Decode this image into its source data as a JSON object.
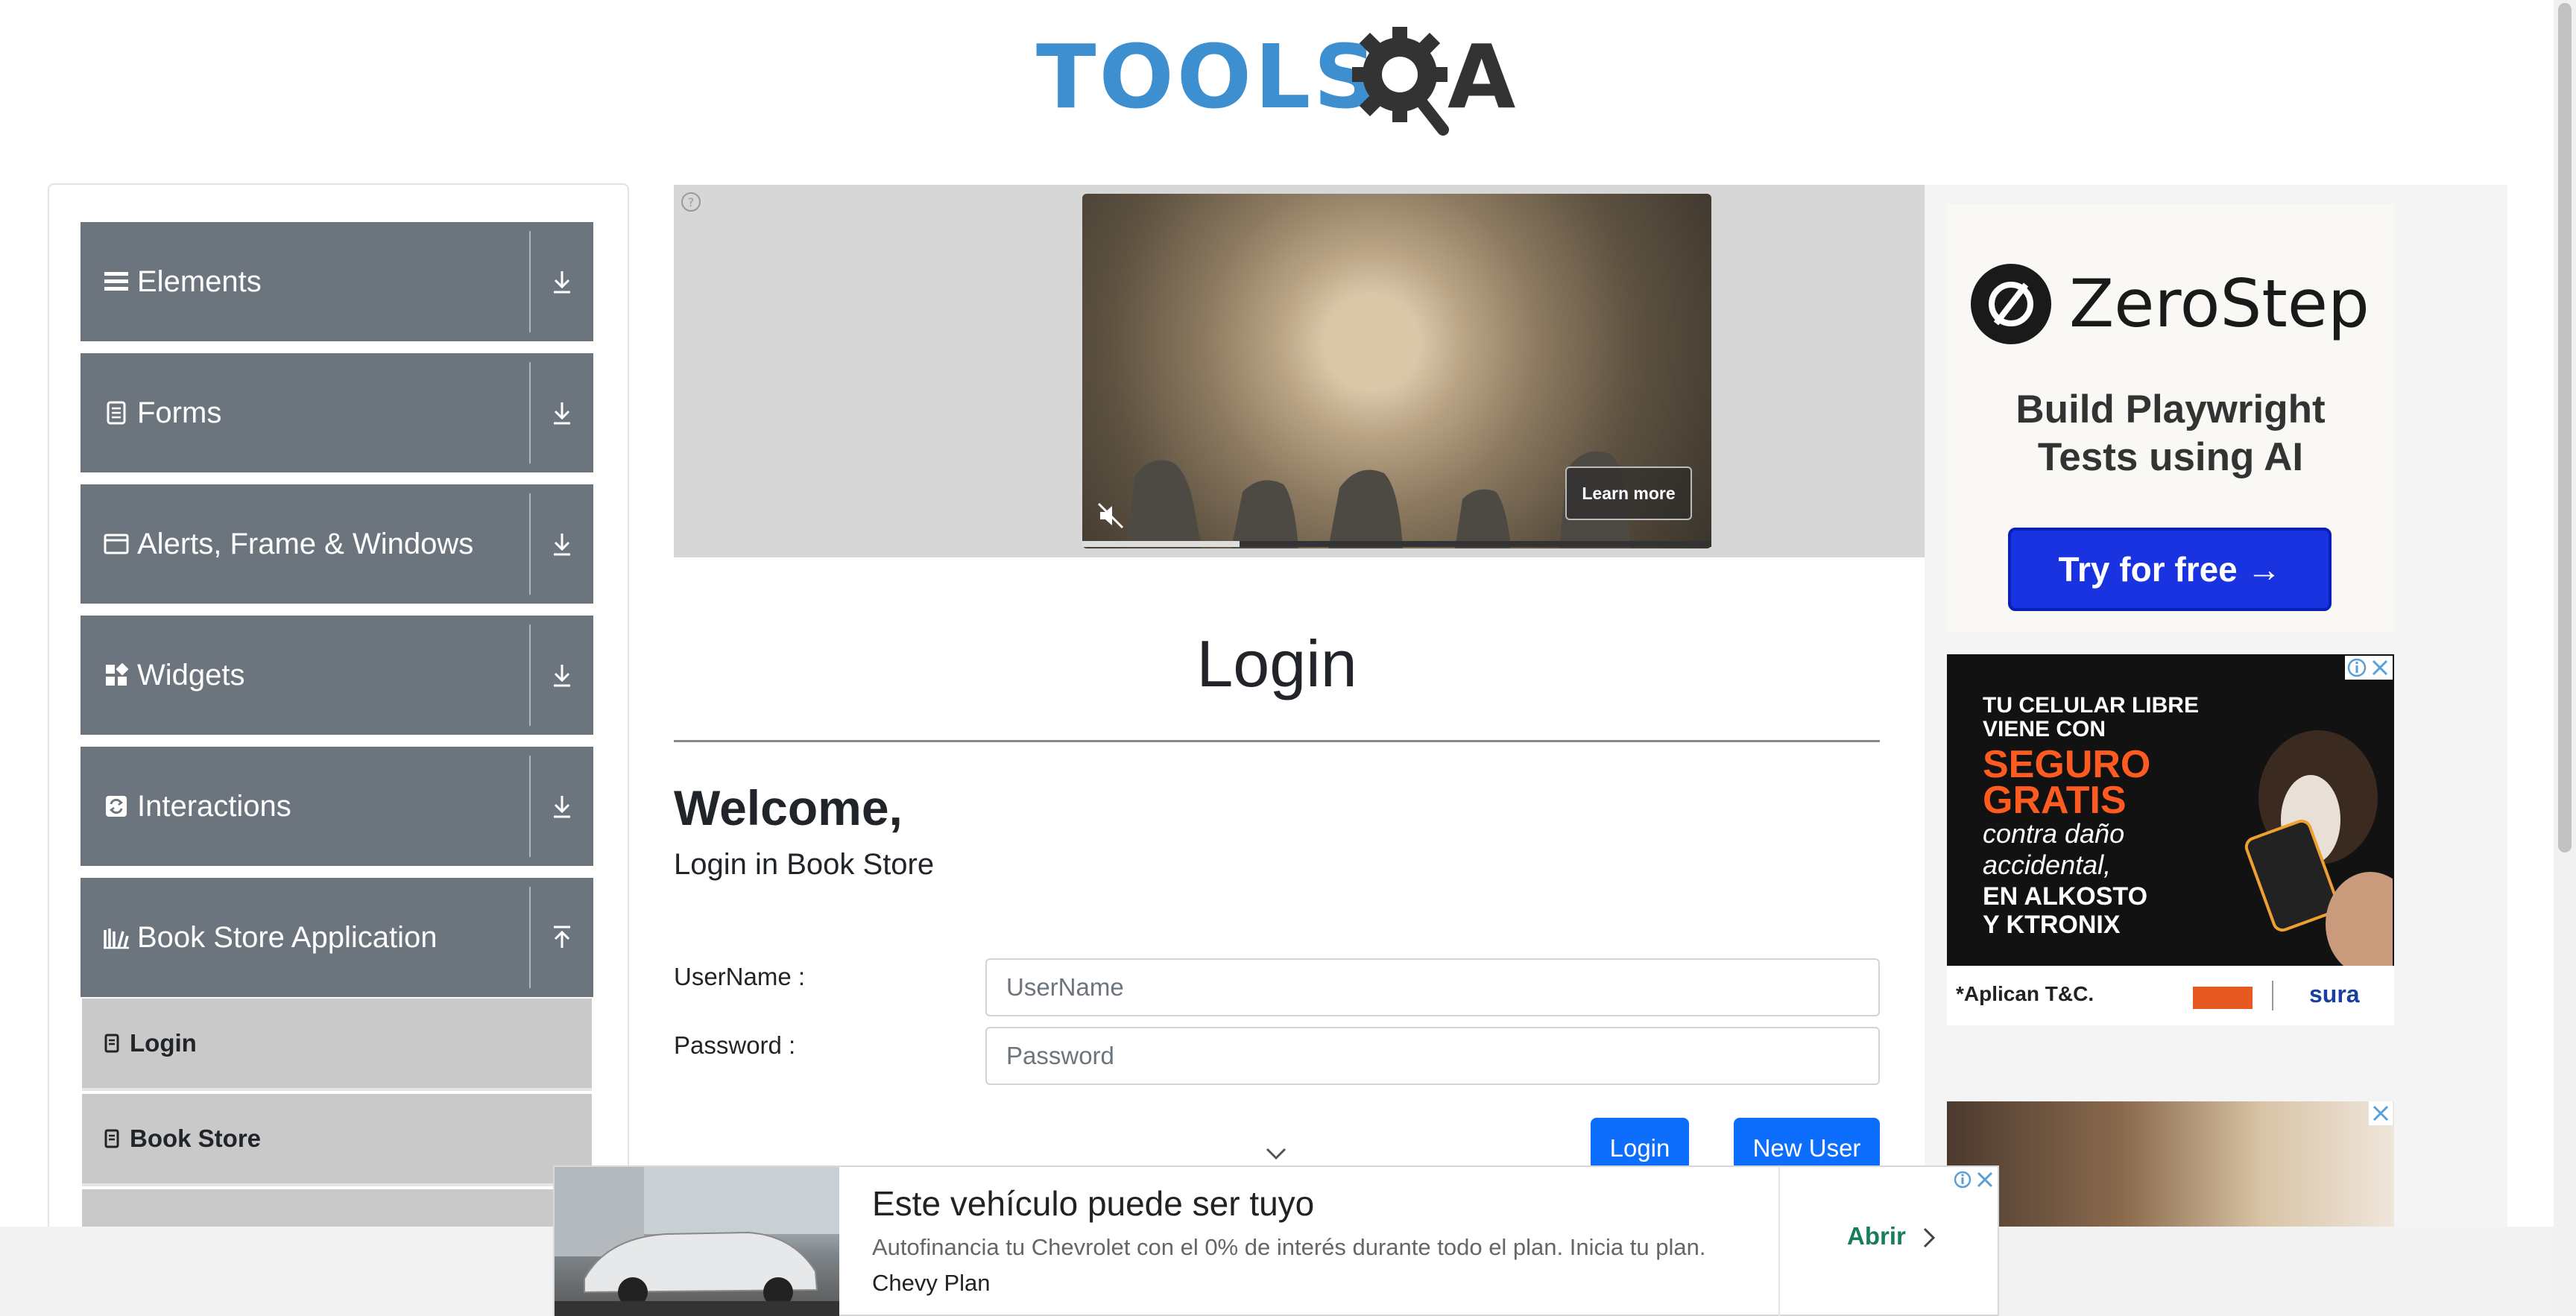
{
  "brand": {
    "logo_text_a": "TOOLS",
    "logo_text_b": "A"
  },
  "sidebar": {
    "groups": [
      {
        "label": "Elements",
        "icon": "hamburger-icon"
      },
      {
        "label": "Forms",
        "icon": "document-icon"
      },
      {
        "label": "Alerts, Frame & Windows",
        "icon": "window-icon"
      },
      {
        "label": "Widgets",
        "icon": "widgets-icon"
      },
      {
        "label": "Interactions",
        "icon": "interactions-icon"
      },
      {
        "label": "Book Store Application",
        "icon": "books-icon"
      }
    ],
    "subitems": [
      {
        "label": "Login"
      },
      {
        "label": "Book Store"
      }
    ]
  },
  "video_ad": {
    "learn_more": "Learn more",
    "progress": 0.25
  },
  "main": {
    "title": "Login",
    "welcome": "Welcome,",
    "subtitle": "Login in Book Store",
    "username_label": "UserName :",
    "username_placeholder": "UserName",
    "password_label": "Password :",
    "password_placeholder": "Password",
    "login_button": "Login",
    "new_user_button": "New User"
  },
  "right_ads": {
    "zerostep": {
      "name": "ZeroStep",
      "tagline_1": "Build Playwright",
      "tagline_2": "Tests using AI",
      "cta": "Try for free →"
    },
    "celular": {
      "line1": "TU CELULAR LIBRE",
      "line2": "VIENE CON",
      "line3": "SEGURO",
      "line4": "GRATIS",
      "line5": "contra daño",
      "line6": "accidental,",
      "line7": "EN ALKOSTO",
      "line8": "Y KTRONIX",
      "footnote": "*Aplican T&C.",
      "brand_right": "sura"
    }
  },
  "bottom_ad": {
    "title": "Este vehículo puede ser tuyo",
    "description": "Autofinancia tu Chevrolet con el 0% de interés durante todo el plan. Inicia tu plan.",
    "brand": "Chevy Plan",
    "cta": "Abrir"
  },
  "colors": {
    "sidebar_group": "#6c757d",
    "primary": "#0d6efd",
    "zerostep_button": "#1a33e0",
    "sale_orange": "#ff5a1f"
  }
}
